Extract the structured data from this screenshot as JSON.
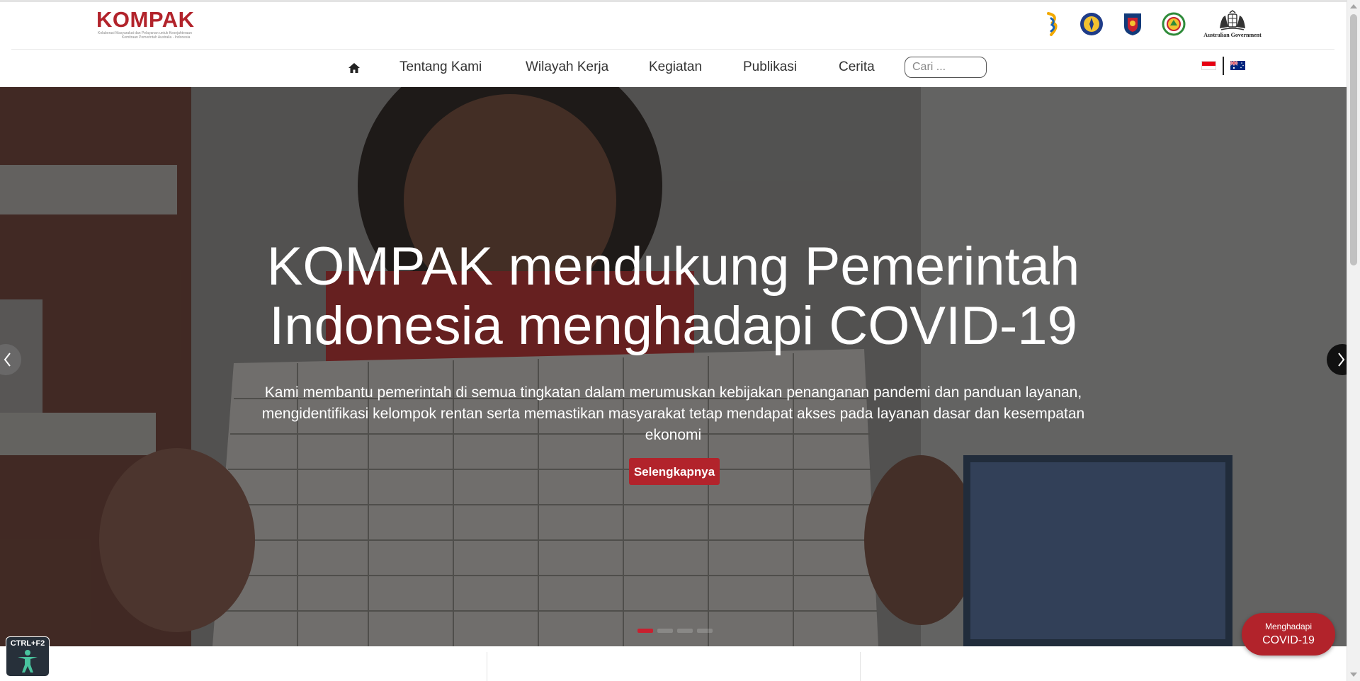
{
  "brand": {
    "logo_text": "KOMPAK",
    "logo_subtitle_1": "Kolaborasi Masyarakat dan Pelayanan untuk Kesejahteraan",
    "logo_subtitle_2": "Kemitraan Pemerintah Australia - Indonesia",
    "color": "#b2232b"
  },
  "partners": {
    "aus_gov_label": "Australian Government"
  },
  "nav": {
    "home_icon": "home-icon",
    "items": [
      {
        "label": "Tentang Kami"
      },
      {
        "label": "Wilayah Kerja"
      },
      {
        "label": "Kegiatan"
      },
      {
        "label": "Publikasi"
      },
      {
        "label": "Cerita"
      }
    ],
    "search_placeholder": "Cari ..."
  },
  "languages": [
    "id",
    "en-au"
  ],
  "hero": {
    "title": "KOMPAK mendukung Pemerintah Indonesia menghadapi COVID-19",
    "description": "Kami membantu pemerintah di semua tingkatan dalam merumuskan kebijakan penanganan pandemi dan panduan layanan, mengidentifikasi kelompok rentan serta memastikan masyarakat tetap mendapat akses pada layanan dasar dan kesempatan ekonomi",
    "cta_label": "Selengkapnya",
    "slide_count": 4,
    "active_slide": 1
  },
  "floating": {
    "covid_line1": "Menghadapi",
    "covid_line2": "COVID-19",
    "accessibility_shortcut": "CTRL+F2",
    "accessibility_icon": "accessibility-person-icon"
  }
}
